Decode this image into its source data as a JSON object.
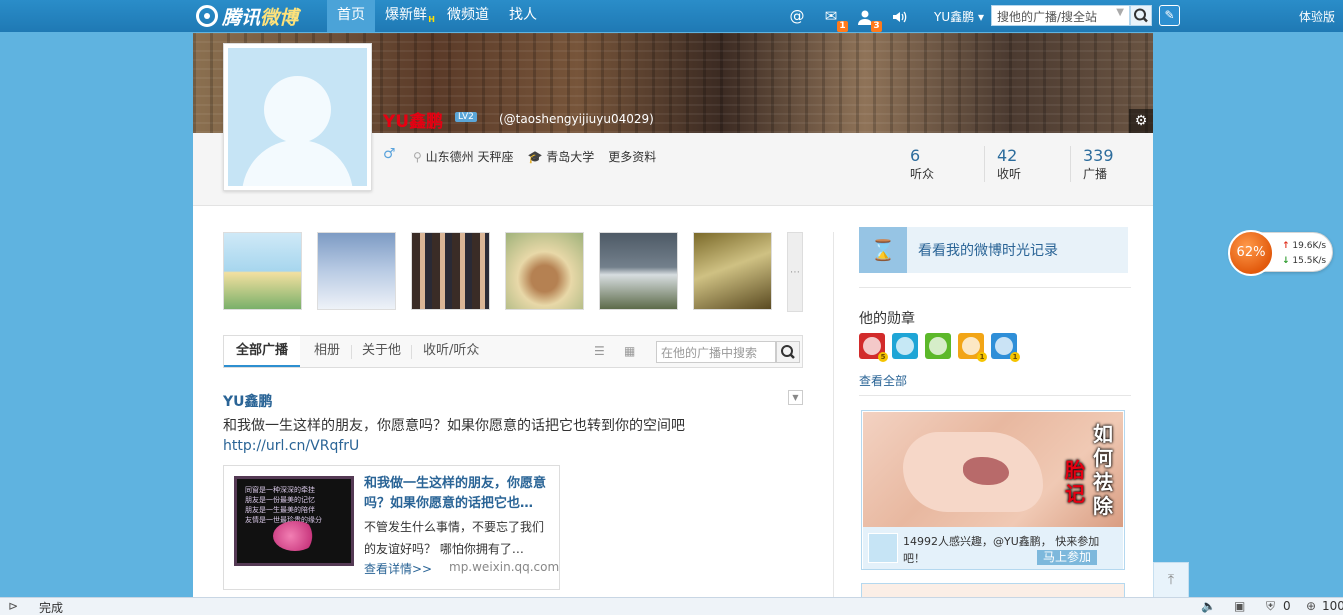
{
  "topbar": {
    "logo_main": "腾讯",
    "logo_accent": "微博",
    "nav": [
      {
        "label": "首页",
        "active": true
      },
      {
        "label": "爆新鲜",
        "hot": "H"
      },
      {
        "label": "微频道"
      },
      {
        "label": "找人"
      }
    ],
    "icons": [
      {
        "name": "at-icon",
        "glyph": "@",
        "badge": ""
      },
      {
        "name": "mail-icon",
        "glyph": "✉",
        "badge": "1"
      },
      {
        "name": "user-icon",
        "glyph": "👤",
        "badge": "3"
      },
      {
        "name": "speaker-icon",
        "glyph": "🔊",
        "badge": ""
      }
    ],
    "user": "YU鑫鹏",
    "search_placeholder": "搜他的广播/搜全站",
    "trial": "体验版"
  },
  "profile": {
    "name": "YU鑫鹏",
    "level": "LV2",
    "handle": "(@taoshengyijiuyu04029)",
    "location": "山东德州 天秤座",
    "school": "青岛大学",
    "more": "更多资料",
    "stats": [
      {
        "num": "6",
        "label": "听众"
      },
      {
        "num": "42",
        "label": "收听"
      },
      {
        "num": "339",
        "label": "广播"
      }
    ]
  },
  "tabs": {
    "items": [
      "全部广播",
      "相册",
      "关于他",
      "收听/听众"
    ],
    "search_placeholder": "在他的广播中搜索"
  },
  "post": {
    "author": "YU鑫鹏",
    "text": "和我做一生这样的朋友，你愿意吗？如果你愿意的话把它也转到你的空间吧",
    "link": "http://url.cn/VRqfrU",
    "card": {
      "title": "和我做一生这样的朋友，你愿意吗？如果你愿意的话把它也…",
      "desc": "不管发生什么事情，不要忘了我们的友谊好吗？ 哪怕你拥有了…",
      "more": "查看详情>>",
      "source": "mp.weixin.qq.com"
    }
  },
  "sidebar": {
    "timeline": "看看我的微博时光记录",
    "medals_title": "他的勋章",
    "medals": [
      {
        "color": "#d22b2b",
        "level": "5"
      },
      {
        "color": "#1fa5d6",
        "level": ""
      },
      {
        "color": "#5cb82a",
        "level": ""
      },
      {
        "color": "#f2a516",
        "level": "1"
      },
      {
        "color": "#2f8fd8",
        "level": "1"
      }
    ],
    "view_all": "查看全部",
    "ad": {
      "vtext_1": "如何祛除",
      "vtext_2": "胎记",
      "interest": "14992人感兴趣，@YU鑫鹏， 快来参加吧！",
      "join": "马上参加"
    }
  },
  "speed": {
    "percent": "62%",
    "up": "19.6K/s",
    "down": "15.5K/s"
  },
  "status": {
    "text": "完成",
    "counter": "0",
    "zoom": "100"
  }
}
